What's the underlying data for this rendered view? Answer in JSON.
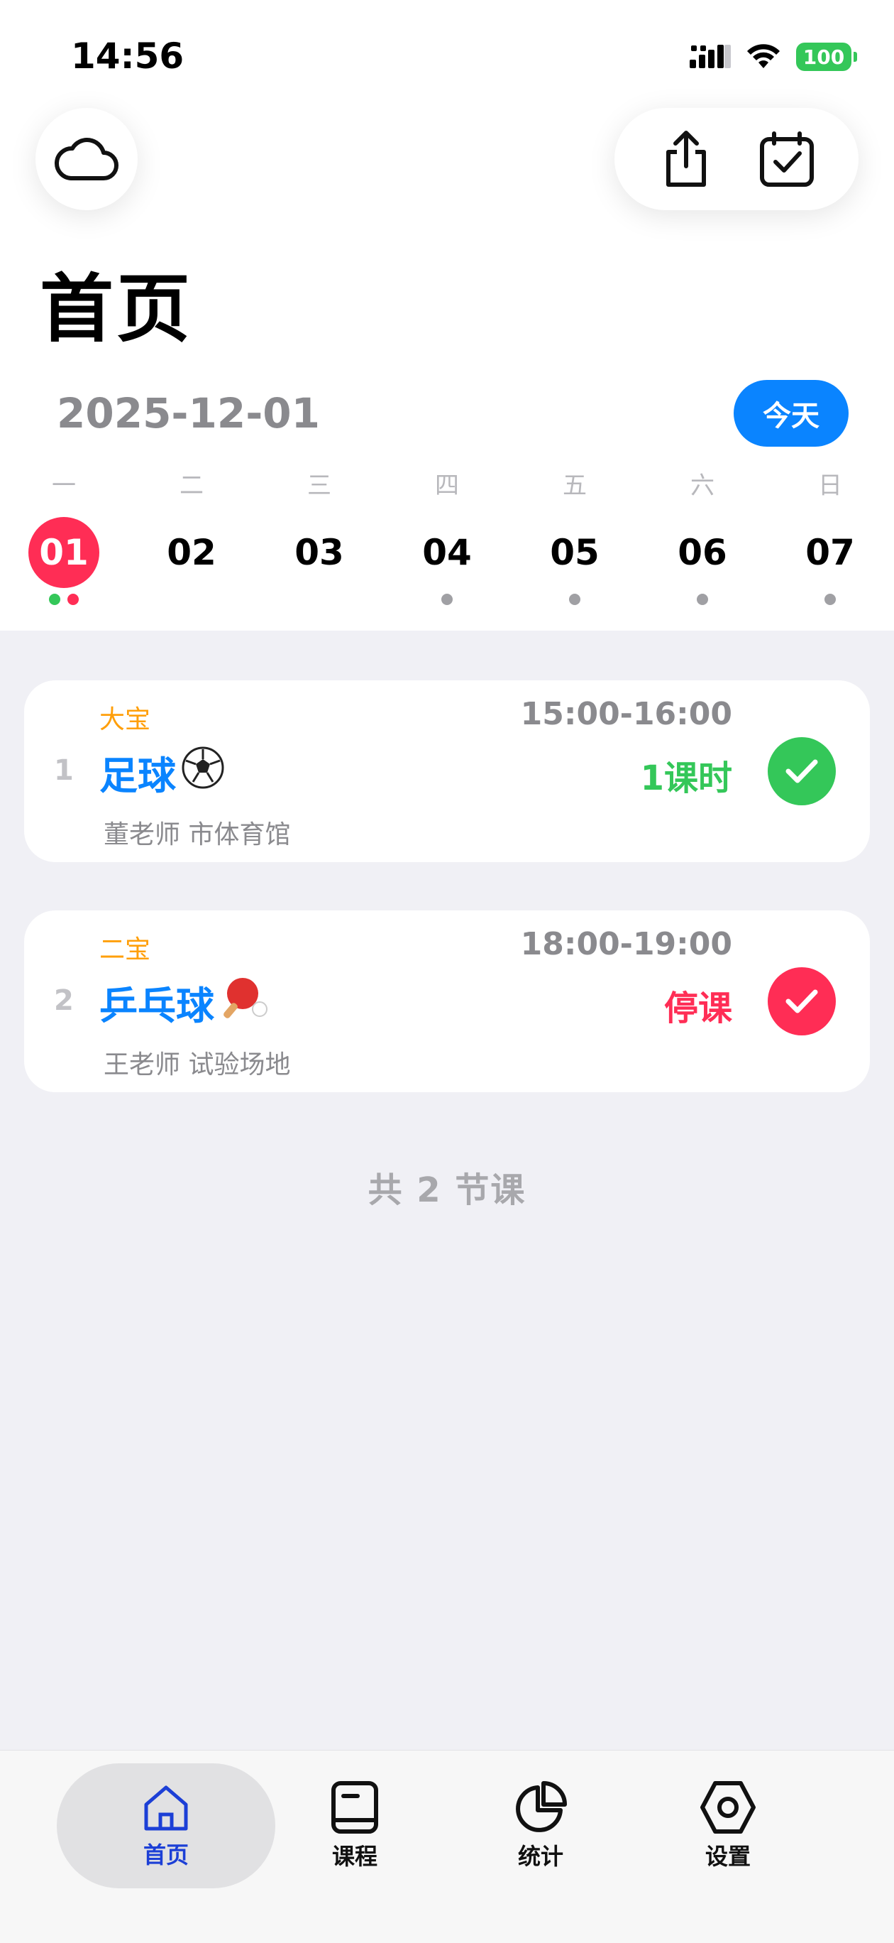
{
  "status_bar": {
    "time": "14:56",
    "battery": "100"
  },
  "header": {
    "title": "首页"
  },
  "date_bar": {
    "date": "2025-12-01",
    "today_label": "今天"
  },
  "week": {
    "weekday_labels": [
      "一",
      "二",
      "三",
      "四",
      "五",
      "六",
      "日"
    ],
    "days": [
      {
        "num": "01",
        "selected": true,
        "dots": [
          "#34c759",
          "#ff2d55"
        ]
      },
      {
        "num": "02",
        "selected": false,
        "dots": []
      },
      {
        "num": "03",
        "selected": false,
        "dots": []
      },
      {
        "num": "04",
        "selected": false,
        "dots": [
          "#a0a0a4"
        ]
      },
      {
        "num": "05",
        "selected": false,
        "dots": [
          "#a0a0a4"
        ]
      },
      {
        "num": "06",
        "selected": false,
        "dots": [
          "#a0a0a4"
        ]
      },
      {
        "num": "07",
        "selected": false,
        "dots": [
          "#a0a0a4"
        ]
      }
    ]
  },
  "lessons": [
    {
      "index": "1",
      "child": "大宝",
      "time": "15:00-16:00",
      "course": "足球",
      "course_icon": "soccer-ball-icon",
      "status": "1课时",
      "status_color": "#34c759",
      "meta": "董老师 市体育馆",
      "check_color": "#34c759"
    },
    {
      "index": "2",
      "child": "二宝",
      "time": "18:00-19:00",
      "course": "乒乓球",
      "course_icon": "ping-pong-icon",
      "status": "停课",
      "status_color": "#ff2d55",
      "meta": "王老师 试验场地",
      "check_color": "#ff2d55"
    }
  ],
  "summary": {
    "total": "共 2 节课"
  },
  "tabbar": {
    "items": [
      {
        "label": "首页",
        "icon": "home-icon",
        "active": true
      },
      {
        "label": "课程",
        "icon": "book-icon",
        "active": false
      },
      {
        "label": "统计",
        "icon": "pie-chart-icon",
        "active": false
      },
      {
        "label": "设置",
        "icon": "settings-hexagon-icon",
        "active": false
      }
    ]
  },
  "colors": {
    "accent": "#0a84ff",
    "selected_day": "#ff2d55",
    "child_label": "#ff9f0a",
    "tab_active": "#1c3fd6"
  }
}
